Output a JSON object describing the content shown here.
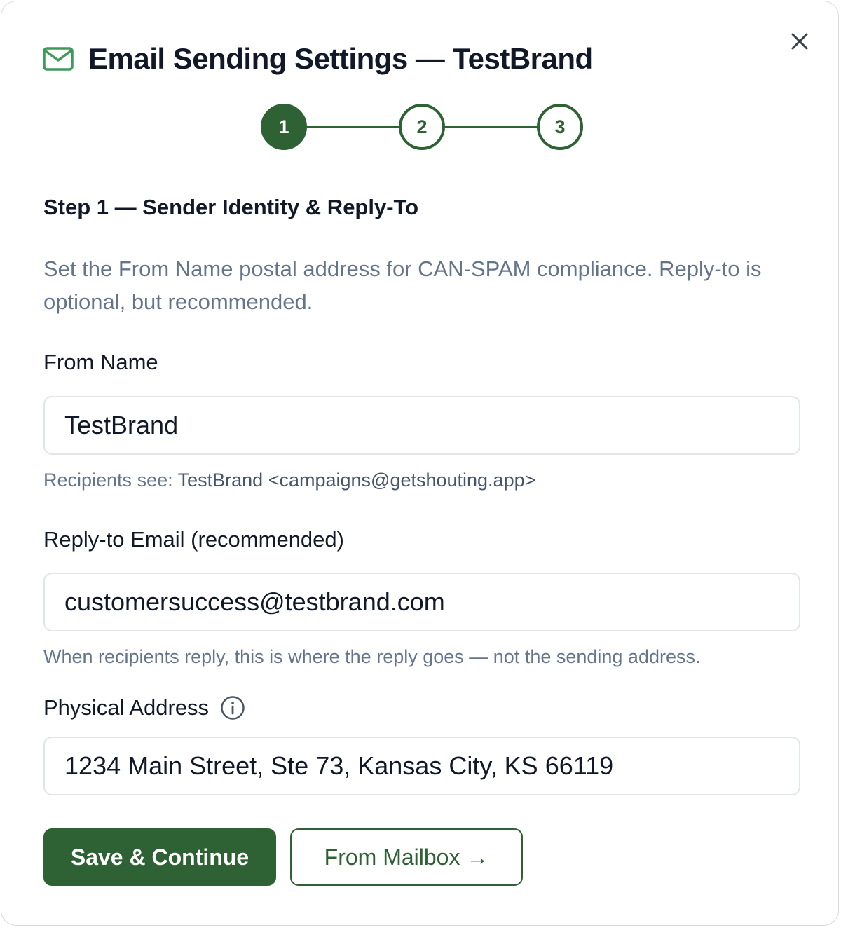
{
  "dialog": {
    "title": "Email Sending Settings — TestBrand",
    "title_icon": "mail-icon",
    "close_icon": "close-icon"
  },
  "stepper": {
    "steps": [
      {
        "label": "1",
        "state": "active"
      },
      {
        "label": "2",
        "state": "inactive"
      },
      {
        "label": "3",
        "state": "inactive"
      }
    ],
    "accent_color": "#2e6133"
  },
  "step": {
    "heading": "Step 1 — Sender Identity & Reply-To",
    "description": "Set the From Name postal address for CAN-SPAM compliance. Reply-to is optional, but recommended."
  },
  "fields": {
    "from_name": {
      "label": "From Name",
      "value": "TestBrand",
      "hint_prefix": "Recipients see:",
      "hint_value": "TestBrand <campaigns@getshouting.app>"
    },
    "reply_to": {
      "label": "Reply-to Email (recommended)",
      "value": "customersuccess@testbrand.com",
      "hint": "When recipients reply, this is where the reply goes — not the sending address."
    },
    "physical_address": {
      "label": "Physical Address",
      "info_icon": "info-icon",
      "value": "1234 Main Street, Ste 73, Kansas City, KS 66119"
    }
  },
  "actions": {
    "primary_label": "Save & Continue",
    "secondary_label": "From Mailbox →"
  },
  "colors": {
    "brand_green": "#2e6133",
    "muted_text": "#64748b",
    "border": "#e2e5e9"
  }
}
